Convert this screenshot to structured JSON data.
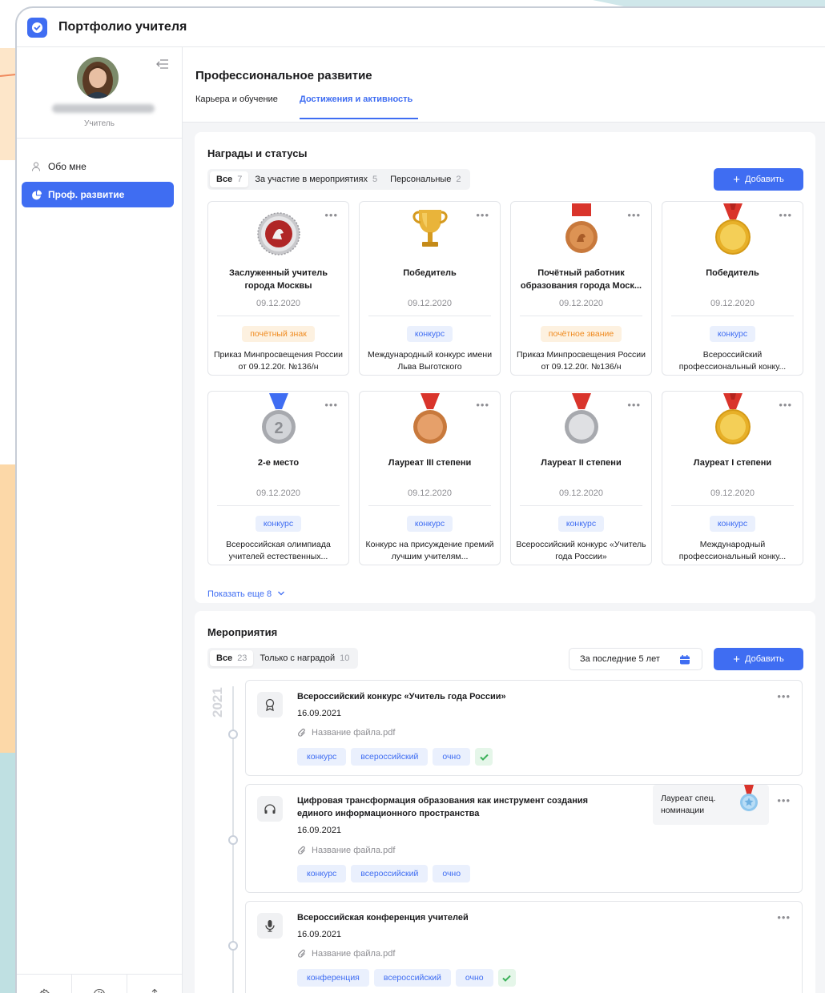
{
  "app": {
    "title": "Портфолио учителя"
  },
  "colors": {
    "accent": "#3f6df2",
    "orange": "#ef8a1f",
    "success": "#3bb159"
  },
  "sidebar": {
    "role": "Учитель",
    "items": [
      {
        "label": "Обо мне",
        "icon": "user-icon"
      },
      {
        "label": "Проф. развитие",
        "icon": "pie-chart-icon",
        "active": true
      }
    ],
    "bottom_icons": [
      "settings-icon",
      "palette-icon",
      "share-icon"
    ]
  },
  "header": {
    "title": "Профессиональное развитие",
    "tabs": [
      {
        "label": "Карьера и обучение"
      },
      {
        "label": "Достижения и активность",
        "active": true
      }
    ]
  },
  "awards": {
    "title": "Награды и статусы",
    "filters": [
      {
        "label": "Все",
        "count": "7"
      },
      {
        "label": "За участие в мероприятиях",
        "count": "5"
      },
      {
        "label": "Персональные",
        "count": "2"
      }
    ],
    "add_label": "Добавить",
    "show_more": "Показать еще 8",
    "cards": [
      {
        "name": "Заслуженный учитель города Москвы",
        "date": "09.12.2020",
        "badge": "почётный знак",
        "badge_type": "orange",
        "desc": "Приказ Минпросвещения России от 09.12.20г. №136/н",
        "medal": "emblem"
      },
      {
        "name": "Победитель",
        "date": "09.12.2020",
        "badge": "конкурс",
        "badge_type": "blue",
        "desc": "Международный конкурс имени Льва Выготского",
        "medal": "cup"
      },
      {
        "name": "Почётный работник образования города Моск...",
        "date": "09.12.2020",
        "badge": "почётное звание",
        "badge_type": "orange",
        "desc": "Приказ Минпросвещения России от 09.12.20г. №136/н",
        "medal": "bronze-emblem"
      },
      {
        "name": "Победитель",
        "date": "09.12.2020",
        "badge": "конкурс",
        "badge_type": "blue",
        "desc": "Всероссийский профессиональный конку...",
        "medal": "gold"
      },
      {
        "name": "2-е место",
        "date": "09.12.2020",
        "badge": "конкурс",
        "badge_type": "blue",
        "desc": "Всероссийская олимпиада учителей естественных...",
        "medal": "silver-2"
      },
      {
        "name": "Лауреат III степени",
        "date": "09.12.2020",
        "badge": "конкурс",
        "badge_type": "blue",
        "desc": "Конкурс на присуждение премий лучшим учителям...",
        "medal": "bronze"
      },
      {
        "name": "Лауреат II степени",
        "date": "09.12.2020",
        "badge": "конкурс",
        "badge_type": "blue",
        "desc": "Всероссийский конкурс «Учитель года России»",
        "medal": "silver"
      },
      {
        "name": "Лауреат I степени",
        "date": "09.12.2020",
        "badge": "конкурс",
        "badge_type": "blue",
        "desc": "Международный профессиональный конку...",
        "medal": "gold"
      }
    ]
  },
  "events": {
    "title": "Мероприятия",
    "filters": [
      {
        "label": "Все",
        "count": "23"
      },
      {
        "label": "Только с наградой",
        "count": "10"
      }
    ],
    "period": "За последние 5 лет",
    "add_label": "Добавить",
    "year": "2021",
    "items": [
      {
        "title": "Всероссийский конкурс «Учитель года России»",
        "date": "16.09.2021",
        "file": "Название файла.pdf",
        "tags": [
          "конкурс",
          "всероссийский",
          "очно"
        ],
        "verified": true,
        "icon": "award-icon"
      },
      {
        "title": "Цифровая трансформация образования как инструмент создания",
        "title2": "единого информационного пространства",
        "date": "16.09.2021",
        "file": "Название файла.pdf",
        "tags": [
          "конкурс",
          "всероссийский",
          "очно"
        ],
        "verified": false,
        "icon": "headphones-icon",
        "award": "Лауреат спец. номинации"
      },
      {
        "title": "Всероссийская конференция учителей",
        "date": "16.09.2021",
        "file": "Название файла.pdf",
        "tags": [
          "конференция",
          "всероссийский",
          "очно"
        ],
        "verified": true,
        "icon": "microphone-icon"
      }
    ]
  }
}
